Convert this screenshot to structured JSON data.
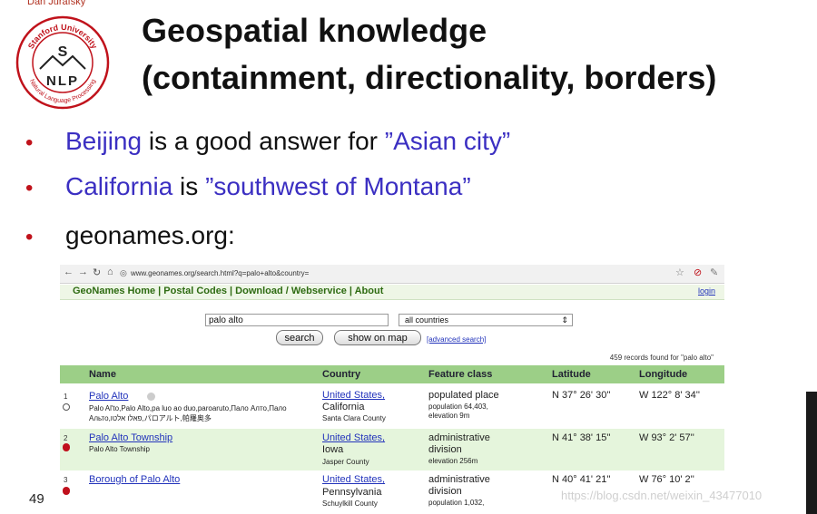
{
  "slide": {
    "author": "Dan Jurafsky",
    "logo_text": {
      "top": "Stanford University",
      "bottom": "Natural Language Processing",
      "s": "S",
      "nlp": "NLP"
    },
    "title_line1": "Geospatial knowledge",
    "title_line2": "(containment, directionality, borders)",
    "bullet1": {
      "term": "Beijing",
      "mid": " is a good answer for ",
      "quote": "”Asian city”"
    },
    "bullet2": {
      "term": "California",
      "mid": " is ",
      "quote": "”southwest of Montana”"
    },
    "bullet3": "geonames.org:",
    "slide_number": "49",
    "watermark": "https://blog.csdn.net/weixin_43477010"
  },
  "browser": {
    "url": "www.geonames.org/search.html?q=palo+alto&country=",
    "nav_links": "GeoNames Home | Postal Codes | Download / Webservice | About",
    "login": "login",
    "search_value": "palo alto",
    "country_value": "all countries",
    "search_button": "search",
    "map_button": "show on map",
    "advanced_search": "[advanced search]",
    "records_found": "459 records found for \"palo alto\"",
    "columns": {
      "name": "Name",
      "country": "Country",
      "feature": "Feature class",
      "lat": "Latitude",
      "lon": "Longitude"
    },
    "rows": [
      {
        "num": "1",
        "name": "Palo Alto",
        "alt": "Palo Al'to,Palo Alto,pa luo ao duo,paroaruto,Пало Алто,Пало Альто,פאלו אלטו,パロアルト,帕羅奥多",
        "country": "United States,",
        "region": "California",
        "county": "Santa Clara County",
        "fc": "populated place",
        "fc_small1": "population 64,403,",
        "fc_small2": "elevation 9m",
        "lat": "N 37° 26' 30''",
        "lon": "W 122° 8' 34''"
      },
      {
        "num": "2",
        "name": "Palo Alto Township",
        "alt": "Palo Alto Township",
        "country": "United States,",
        "region": "Iowa",
        "county": "Jasper County",
        "fc": "administrative",
        "fc2": "division",
        "fc_small1": "elevation 256m",
        "lat": "N 41° 38' 15''",
        "lon": "W 93° 2' 57''"
      },
      {
        "num": "3",
        "name": "Borough of Palo Alto",
        "country": "United States,",
        "region": "Pennsylvania",
        "county": "Schuylkill County",
        "fc": "administrative",
        "fc2": "division",
        "fc_small1": "population 1,032,",
        "lat": "N 40° 41' 21''",
        "lon": "W 76° 10' 2''"
      }
    ]
  }
}
